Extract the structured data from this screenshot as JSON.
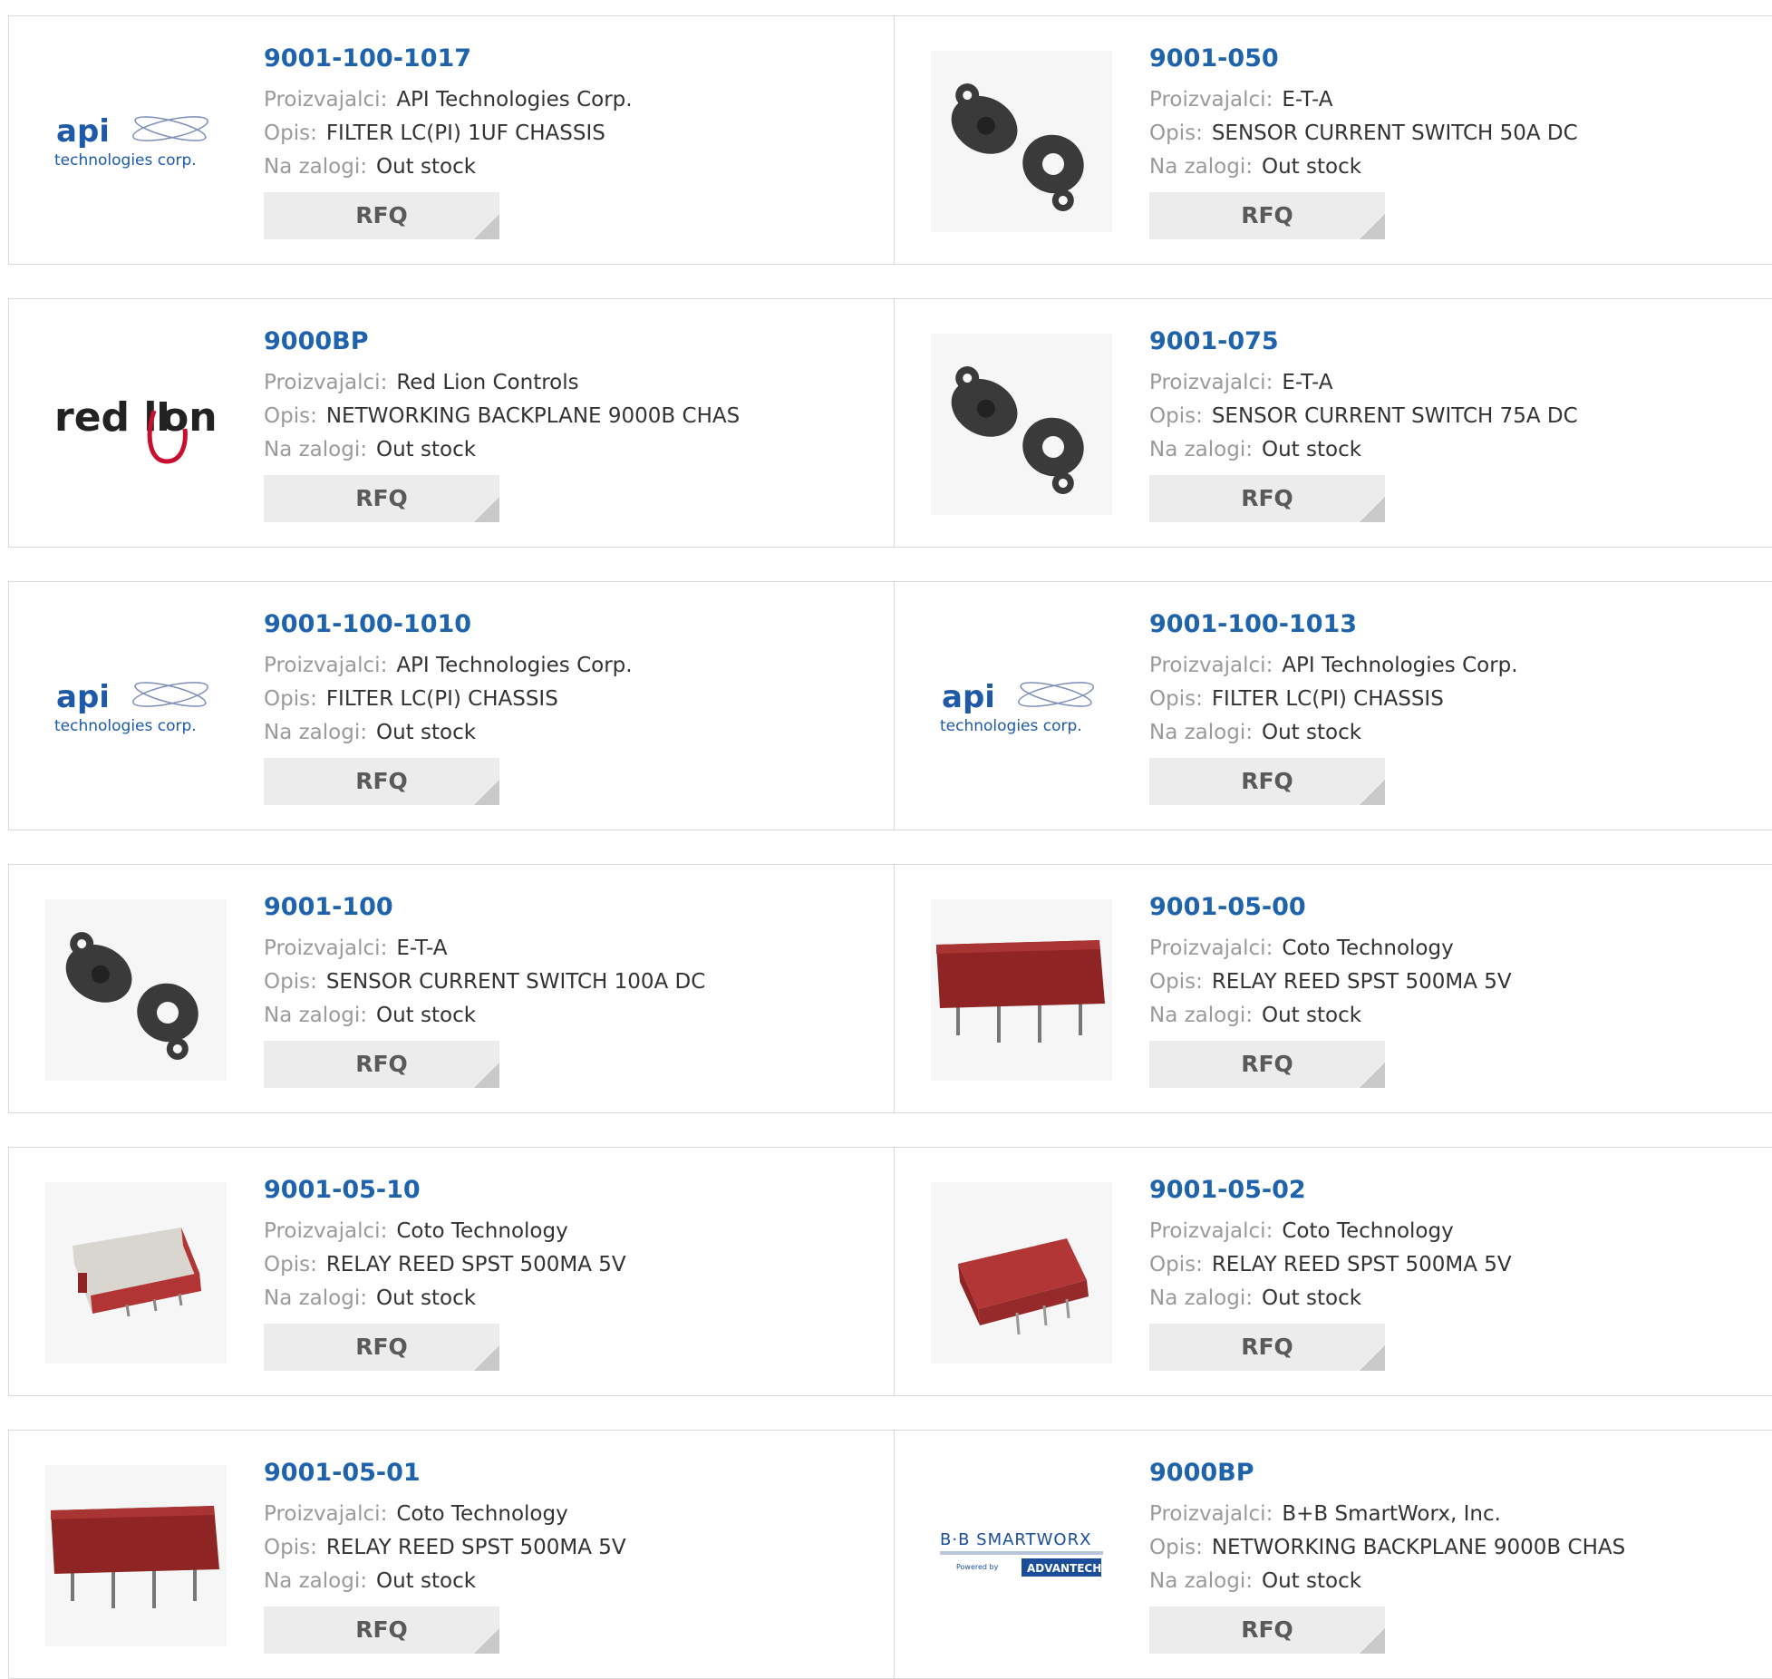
{
  "labels": {
    "manufacturer": "Proizvajalci:",
    "description": "Opis:",
    "stock": "Na zalogi:",
    "rfq": "RFQ"
  },
  "products": [
    {
      "pn": "9001-100-1017",
      "mfr": "API Technologies Corp.",
      "desc": "FILTER LC(PI) 1UF CHASSIS",
      "stock": "Out stock",
      "thumb": "api-logo"
    },
    {
      "pn": "9001-050",
      "mfr": "E-T-A",
      "desc": "SENSOR CURRENT SWITCH 50A DC",
      "stock": "Out stock",
      "thumb": "current-sensor-photo"
    },
    {
      "pn": "9000BP",
      "mfr": "Red Lion Controls",
      "desc": "NETWORKING BACKPLANE 9000B CHAS",
      "stock": "Out stock",
      "thumb": "red-lion-logo"
    },
    {
      "pn": "9001-075",
      "mfr": "E-T-A",
      "desc": "SENSOR CURRENT SWITCH 75A DC",
      "stock": "Out stock",
      "thumb": "current-sensor-photo"
    },
    {
      "pn": "9001-100-1010",
      "mfr": "API Technologies Corp.",
      "desc": "FILTER LC(PI) CHASSIS",
      "stock": "Out stock",
      "thumb": "api-logo"
    },
    {
      "pn": "9001-100-1013",
      "mfr": "API Technologies Corp.",
      "desc": "FILTER LC(PI) CHASSIS",
      "stock": "Out stock",
      "thumb": "api-logo"
    },
    {
      "pn": "9001-100",
      "mfr": "E-T-A",
      "desc": "SENSOR CURRENT SWITCH 100A DC",
      "stock": "Out stock",
      "thumb": "current-sensor-photo"
    },
    {
      "pn": "9001-05-00",
      "mfr": "Coto Technology",
      "desc": "RELAY REED SPST 500MA 5V",
      "stock": "Out stock",
      "thumb": "reed-relay-side-photo"
    },
    {
      "pn": "9001-05-10",
      "mfr": "Coto Technology",
      "desc": "RELAY REED SPST 500MA 5V",
      "stock": "Out stock",
      "thumb": "reed-relay-grey-photo"
    },
    {
      "pn": "9001-05-02",
      "mfr": "Coto Technology",
      "desc": "RELAY REED SPST 500MA 5V",
      "stock": "Out stock",
      "thumb": "reed-relay-red-photo"
    },
    {
      "pn": "9001-05-01",
      "mfr": "Coto Technology",
      "desc": "RELAY REED SPST 500MA 5V",
      "stock": "Out stock",
      "thumb": "reed-relay-side-photo"
    },
    {
      "pn": "9000BP",
      "mfr": "B+B SmartWorx, Inc.",
      "desc": "NETWORKING BACKPLANE 9000B CHAS",
      "stock": "Out stock",
      "thumb": "bb-smartworx-logo"
    }
  ],
  "logo_text": {
    "api": "api",
    "api_sub": "technologies corp.",
    "redlion_a": "red l",
    "redlion_b": "on",
    "bb_main": "B·B SMARTWORX",
    "bb_powered": "Powered by",
    "bb_adv": "ADVANTECH"
  },
  "colors": {
    "part_number": "#1f63ad",
    "api_blue": "#1e5aa8",
    "redlion_red": "#c8102e",
    "sensor": "#3a3a3a",
    "relay_red": "#8e2424",
    "relay_grey": "#d8d6cf",
    "advantech_blue": "#1a4e9b"
  }
}
